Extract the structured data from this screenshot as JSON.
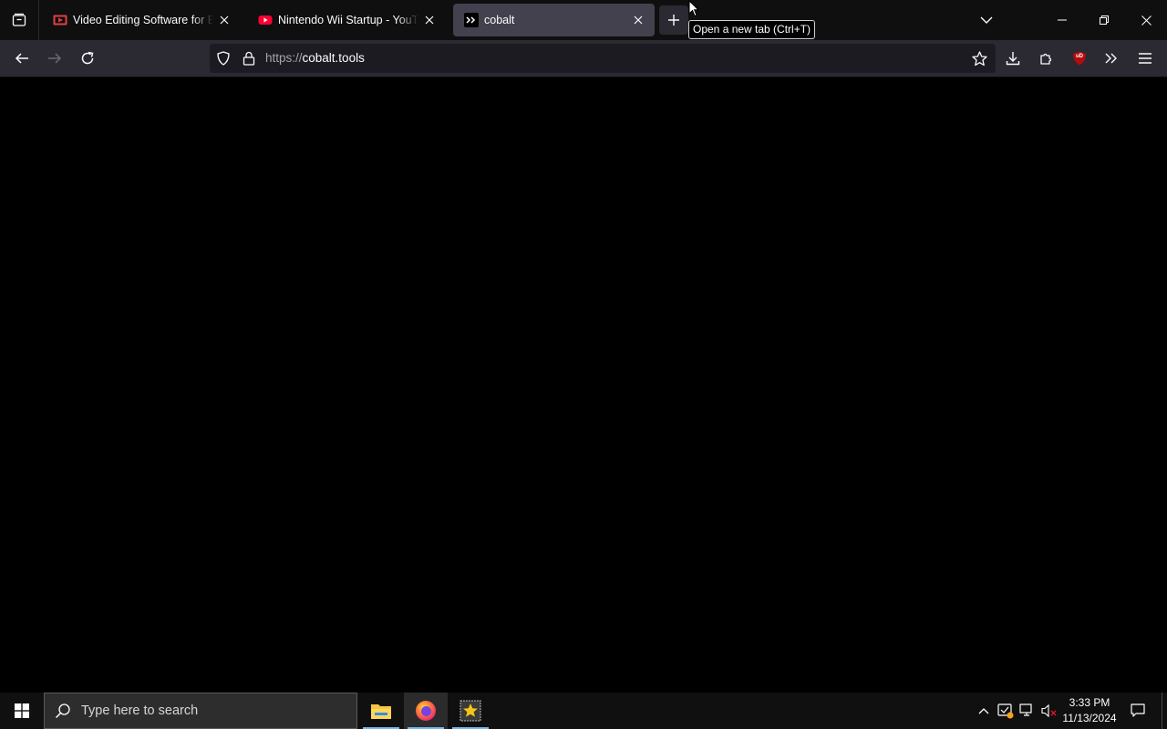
{
  "browser": {
    "tabs": [
      {
        "title": "Video Editing Software for Every",
        "favicon": "video-editor-icon",
        "active": false
      },
      {
        "title": "Nintendo Wii Startup - YouTube",
        "favicon": "youtube-icon",
        "active": false
      },
      {
        "title": "cobalt",
        "favicon": "cobalt-icon",
        "active": true
      }
    ],
    "new_tab_tooltip": "Open a new tab (Ctrl+T)",
    "url_scheme": "https://",
    "url_host": "cobalt.tools",
    "extension_badge": "uD",
    "accent_color": "#42414d"
  },
  "taskbar": {
    "search_placeholder": "Type here to search",
    "pinned_apps": [
      "file-explorer-icon",
      "firefox-icon",
      "movie-maker-icon"
    ],
    "clock_time": "3:33 PM",
    "clock_date": "11/13/2024"
  }
}
